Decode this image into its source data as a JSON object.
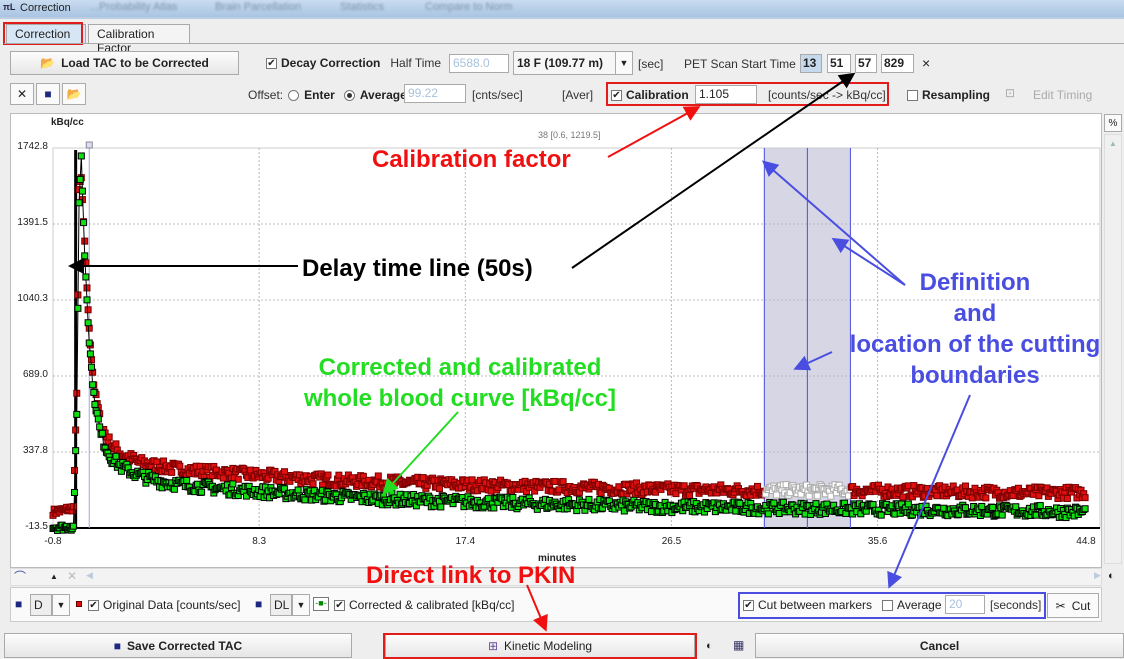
{
  "window": {
    "title": "Correction",
    "background_tabs": [
      "...Probability Atlas",
      "Brain Parcellation",
      "Statistics",
      "Compare to Norm"
    ]
  },
  "tabs": [
    {
      "label": "Correction",
      "active": true
    },
    {
      "label": "Calibration Factor",
      "active": false
    }
  ],
  "toolbar": {
    "load_label": "Load TAC to be Corrected",
    "decay_correction_label": "Decay Correction",
    "decay_checked": true,
    "half_time_label": "Half Time",
    "half_time_value": "6588.0",
    "isotope": "18 F (109.77 m)",
    "sec_unit": "[sec]",
    "pet_start_label": "PET Scan Start Time",
    "pet_start": {
      "h": "13",
      "m": "51",
      "s": "57",
      "ms": "829"
    },
    "clear_glyph": "×",
    "offset_label": "Offset:",
    "enter_label": "Enter",
    "average_label": "Average",
    "offset_mode": "Average",
    "offset_value": "99.22",
    "offset_unit": "[cnts/sec]",
    "aver_label": "[Aver]",
    "calibration_label": "Calibration",
    "calibration_checked": true,
    "calibration_value": "1.105",
    "calibration_unit": "[counts/sec -> kBq/cc]",
    "resampling_label": "Resampling",
    "resampling_checked": false,
    "edit_timing_label": "Edit Timing"
  },
  "chart_data": {
    "type": "scatter",
    "ylabel": "kBq/cc",
    "xlabel": "minutes",
    "info": "38 [0.6, 1219.5]",
    "xlim": [
      -0.8,
      44.8
    ],
    "ylim": [
      -13.5,
      1742.8
    ],
    "xticks": [
      "-0.8",
      "8.3",
      "17.4",
      "26.5",
      "35.6",
      "44.8"
    ],
    "yticks": [
      "1742.8",
      "1391.5",
      "1040.3",
      "689.0",
      "337.8",
      "-13.5"
    ],
    "grid": true,
    "delay_line_x": 0.2,
    "cut_markers_x": [
      30.6,
      32.5,
      34.4
    ],
    "series": [
      {
        "name": "Original Data [counts/sec]",
        "color": "#e01010",
        "x": [
          -0.8,
          -0.3,
          0.1,
          0.25,
          0.35,
          0.45,
          0.6,
          0.8,
          1.0,
          1.3,
          1.7,
          2.2,
          3,
          4,
          5,
          7,
          9,
          12,
          15,
          18,
          22,
          26,
          30,
          34,
          38,
          42,
          44.8
        ],
        "y": [
          60,
          70,
          80,
          600,
          1550,
          1600,
          1300,
          900,
          650,
          470,
          380,
          330,
          290,
          270,
          255,
          240,
          225,
          205,
          195,
          185,
          175,
          165,
          160,
          160,
          155,
          150,
          150
        ]
      },
      {
        "name": "Corrected & calibrated [kBq/cc]",
        "color": "#10e010",
        "x": [
          -0.8,
          -0.3,
          0.1,
          0.25,
          0.35,
          0.45,
          0.6,
          0.8,
          1.0,
          1.3,
          1.7,
          2.2,
          3,
          4,
          5,
          7,
          9,
          12,
          15,
          18,
          22,
          26,
          30,
          34,
          38,
          42,
          44.8
        ],
        "y": [
          -10,
          -10,
          -10,
          500,
          1500,
          1700,
          1250,
          850,
          600,
          420,
          320,
          270,
          230,
          200,
          185,
          165,
          150,
          130,
          115,
          105,
          95,
          85,
          80,
          75,
          70,
          65,
          60
        ]
      }
    ]
  },
  "annotations": {
    "calibration": "Calibration factor",
    "delay": "Delay time line (50s)",
    "corrected": [
      "Corrected and calibrated",
      "whole blood curve [kBq/cc]"
    ],
    "cutting": [
      "Definition",
      "and",
      "location of the cutting",
      "boundaries"
    ],
    "pkin": "Direct link to PKIN"
  },
  "legend": {
    "orig_style": "D",
    "orig_label": "Original Data [counts/sec]",
    "orig_checked": true,
    "corr_style": "DL",
    "corr_label": "Corrected & calibrated [kBq/cc]",
    "corr_checked": true,
    "cut_label": "Cut between markers",
    "cut_checked": true,
    "average_label": "Average",
    "average_checked": false,
    "average_value": "20",
    "seconds_unit": "[seconds]",
    "cut_button": "Cut",
    "percent_label": "%"
  },
  "bottom": {
    "save_label": "Save Corrected TAC",
    "kinetic_label": "Kinetic Modeling",
    "cancel_label": "Cancel"
  },
  "colors": {
    "red_annotation": "#f01010",
    "blue_annotation": "#4a4ee0",
    "green_annotation": "#22dd22",
    "cut_band": "#c8c8dc"
  }
}
